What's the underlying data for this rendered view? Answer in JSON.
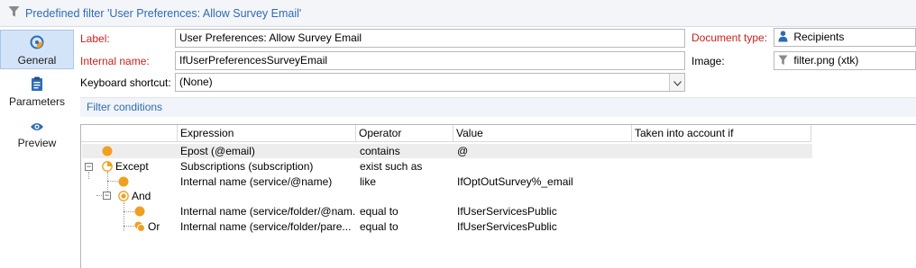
{
  "window": {
    "title": "Predefined filter 'User Preferences: Allow Survey Email'"
  },
  "sidebar": {
    "items": [
      {
        "label": "General",
        "icon": "general-icon",
        "active": true
      },
      {
        "label": "Parameters",
        "icon": "clipboard-icon",
        "active": false
      },
      {
        "label": "Preview",
        "icon": "eye-icon",
        "active": false
      }
    ]
  },
  "form": {
    "label": {
      "label": "Label:",
      "value": "User Preferences: Allow Survey Email"
    },
    "internal_name": {
      "label": "Internal name:",
      "value": "IfUserPreferencesSurveyEmail"
    },
    "keyboard_shortcut": {
      "label": "Keyboard shortcut:",
      "value": "(None)"
    },
    "document_type": {
      "label": "Document type:",
      "value": "Recipients"
    },
    "image": {
      "label": "Image:",
      "value": "filter.png (xtk)"
    }
  },
  "filter_conditions": {
    "title": "Filter conditions",
    "columns": [
      "Expression",
      "Operator",
      "Value",
      "Taken into account if"
    ],
    "rows": [
      {
        "node": "",
        "expression": "Epost (@email)",
        "operator": "contains",
        "value": "@"
      },
      {
        "node": "Except",
        "expression": "Subscriptions (subscription)",
        "operator": "exist such as",
        "value": ""
      },
      {
        "node": "",
        "expression": "Internal name (service/@name)",
        "operator": "like",
        "value": "IfOptOutSurvey%_email"
      },
      {
        "node": "And",
        "expression": "",
        "operator": "",
        "value": ""
      },
      {
        "node": "",
        "expression": "Internal name (service/folder/@nam...",
        "operator": "equal to",
        "value": "IfUserServicesPublic"
      },
      {
        "node": "Or",
        "expression": "Internal name (service/folder/pare...",
        "operator": "equal to",
        "value": "IfUserServicesPublic"
      }
    ]
  },
  "colors": {
    "accent": "#2f6bb5",
    "required_label": "#c8211c",
    "condition_node": "#f0a020",
    "selected_nav": "#d4e4f8"
  }
}
